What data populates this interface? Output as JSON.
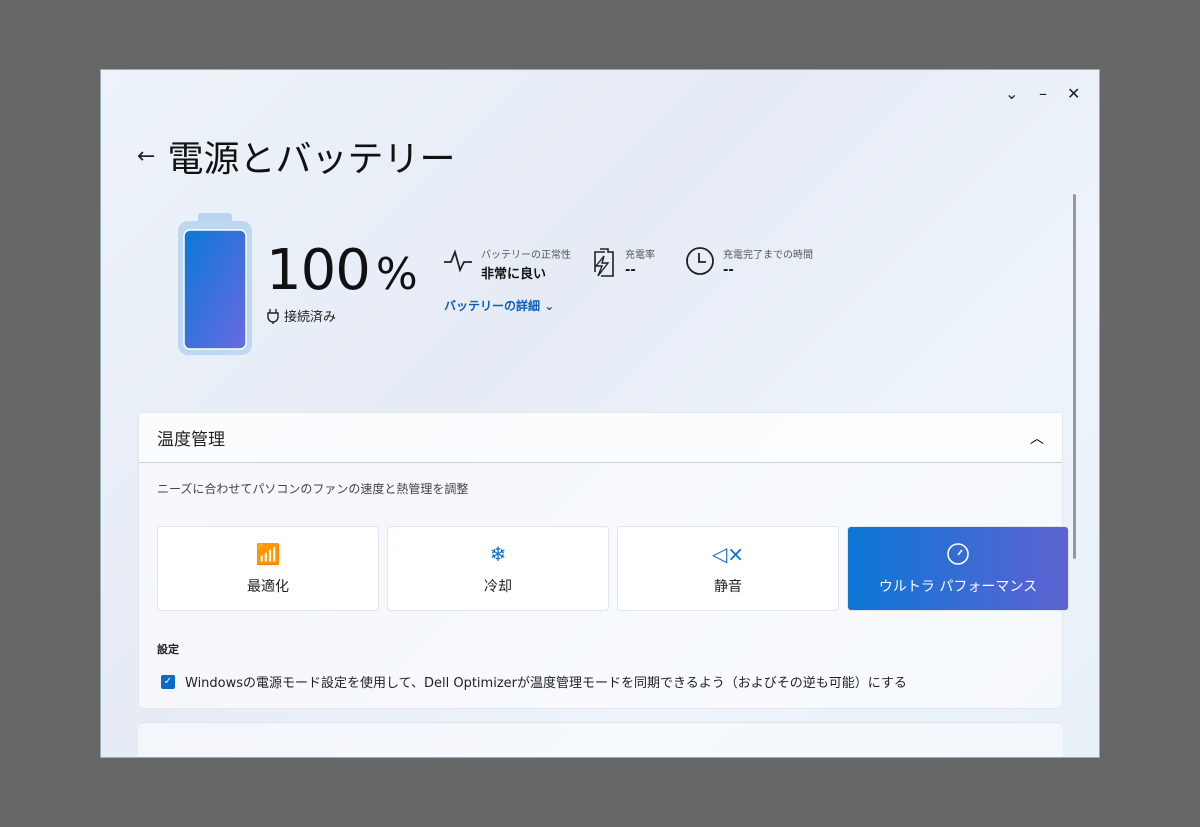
{
  "window": {
    "chevron": "⌄",
    "minimize": "–",
    "close": "✕"
  },
  "header": {
    "back": "←",
    "title": "電源とバッテリー"
  },
  "battery": {
    "level_percent": 100,
    "value": "100",
    "unit": "%",
    "status": "接続済み"
  },
  "stats": [
    {
      "label": "バッテリーの正常性",
      "value": "非常に良い",
      "icon": "heartbeat-icon"
    },
    {
      "label": "充電率",
      "value": "--",
      "icon": "charging-battery-icon"
    },
    {
      "label": "充電完了までの時間",
      "value": "--",
      "icon": "clock-icon"
    }
  ],
  "details_link": "バッテリーの詳細",
  "thermal": {
    "title": "温度管理",
    "description": "ニーズに合わせてパソコンのファンの速度と熱管理を調整",
    "modes": [
      {
        "label": "最適化",
        "icon": "optimize-icon"
      },
      {
        "label": "冷却",
        "icon": "snowflake-icon"
      },
      {
        "label": "静音",
        "icon": "mute-icon"
      },
      {
        "label": "ウルトラ パフォーマンス",
        "icon": "speedometer-icon",
        "selected": true
      }
    ],
    "settings_label": "設定",
    "checkbox_label": "Windowsの電源モード設定を使用して、Dell Optimizerが温度管理モードを同期できるよう（およびその逆も可能）にする",
    "checkbox_checked": true
  }
}
